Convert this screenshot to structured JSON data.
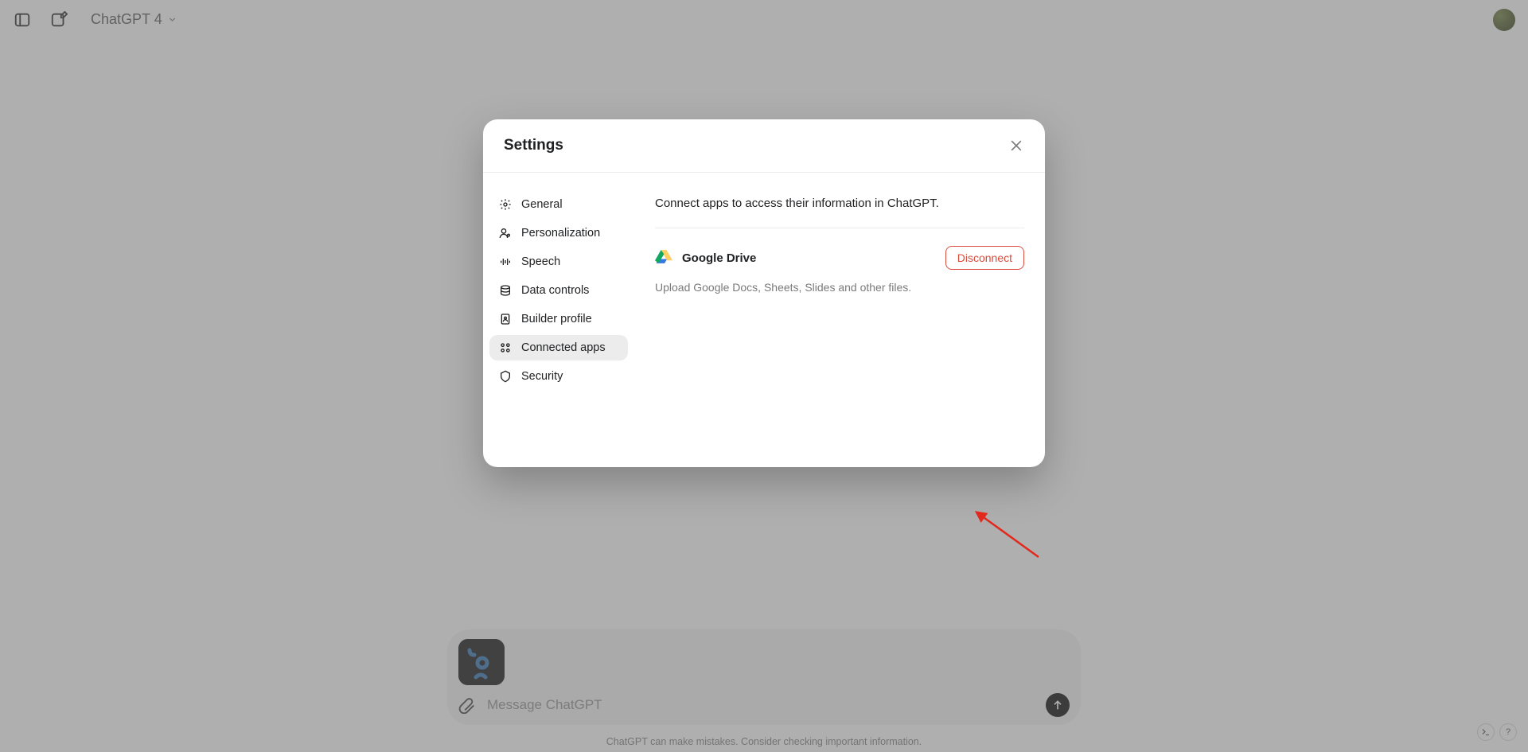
{
  "header": {
    "model_label": "ChatGPT 4"
  },
  "composer": {
    "placeholder": "Message ChatGPT"
  },
  "footnote": "ChatGPT can make mistakes. Consider checking important information.",
  "corner": {
    "help_label": "?"
  },
  "modal": {
    "title": "Settings",
    "nav": {
      "general": "General",
      "personalization": "Personalization",
      "speech": "Speech",
      "data_controls": "Data controls",
      "builder_profile": "Builder profile",
      "connected_apps": "Connected apps",
      "security": "Security"
    },
    "content": {
      "description": "Connect apps to access their information in ChatGPT.",
      "app": {
        "name": "Google Drive",
        "subtext": "Upload Google Docs, Sheets, Slides and other files.",
        "action_label": "Disconnect"
      }
    }
  }
}
